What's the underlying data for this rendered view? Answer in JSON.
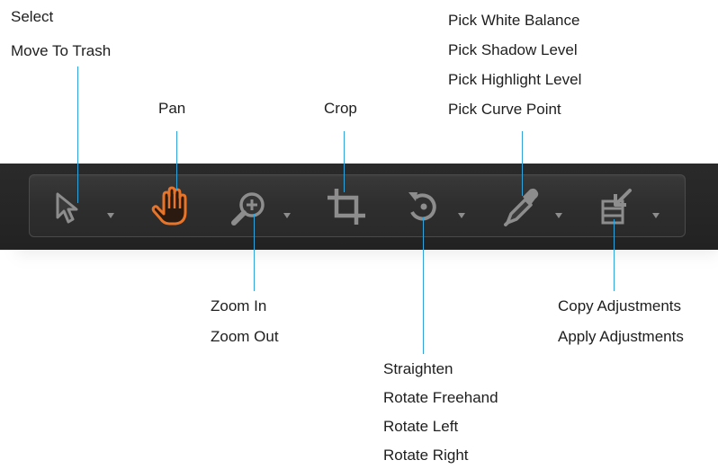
{
  "labels": {
    "select": "Select",
    "move_to_trash": "Move To Trash",
    "pan": "Pan",
    "crop": "Crop",
    "pick_white_balance": "Pick White Balance",
    "pick_shadow_level": "Pick Shadow Level",
    "pick_highlight_level": "Pick Highlight Level",
    "pick_curve_point": "Pick Curve Point",
    "zoom_in": "Zoom In",
    "zoom_out": "Zoom Out",
    "straighten": "Straighten",
    "rotate_freehand": "Rotate Freehand",
    "rotate_left": "Rotate Left",
    "rotate_right": "Rotate Right",
    "copy_adjustments": "Copy Adjustments",
    "apply_adjustments": "Apply Adjustments"
  },
  "colors": {
    "leader_line": "#2fa3dc",
    "toolbar_bg": "#262626",
    "icon_gray": "#8d8d8d",
    "active_orange": "#e8742a"
  },
  "tools": [
    {
      "icon": "arrow-pointer-icon",
      "active": false
    },
    {
      "icon": "hand-icon",
      "active": true
    },
    {
      "icon": "zoom-in-icon",
      "active": false
    },
    {
      "icon": "crop-icon",
      "active": false
    },
    {
      "icon": "rotate-icon",
      "active": false
    },
    {
      "icon": "eyedropper-icon",
      "active": false
    },
    {
      "icon": "copy-adjustments-icon",
      "active": false
    }
  ]
}
